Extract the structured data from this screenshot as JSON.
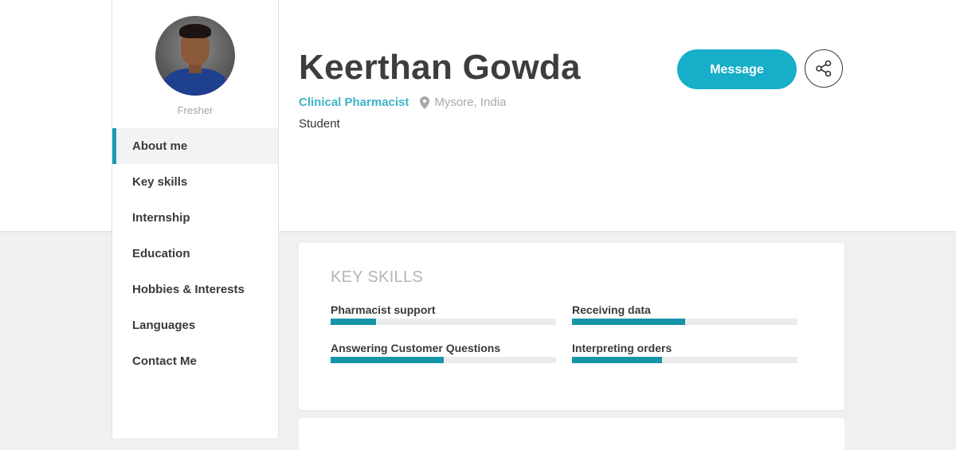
{
  "profile": {
    "experience_level": "Fresher",
    "name": "Keerthan Gowda",
    "job_title": "Clinical Pharmacist",
    "location": "Mysore, India",
    "subtitle": "Student"
  },
  "actions": {
    "message_label": "Message",
    "share_icon": "share-icon"
  },
  "nav": {
    "items": [
      {
        "label": "About me",
        "active": true
      },
      {
        "label": "Key skills",
        "active": false
      },
      {
        "label": "Internship",
        "active": false
      },
      {
        "label": "Education",
        "active": false
      },
      {
        "label": "Hobbies & Interests",
        "active": false
      },
      {
        "label": "Languages",
        "active": false
      },
      {
        "label": "Contact Me",
        "active": false
      }
    ]
  },
  "key_skills": {
    "title": "KEY SKILLS",
    "skills": [
      {
        "label": "Pharmacist support",
        "level": 0.2
      },
      {
        "label": "Receiving data",
        "level": 0.5
      },
      {
        "label": "Answering Customer Questions",
        "level": 0.5
      },
      {
        "label": "Interpreting orders",
        "level": 0.4
      }
    ]
  },
  "colors": {
    "accent": "#17aec9",
    "job_title": "#3eb3c8",
    "skill_fill": "#1596a8",
    "active_nav_border": "#1a9fb0"
  }
}
